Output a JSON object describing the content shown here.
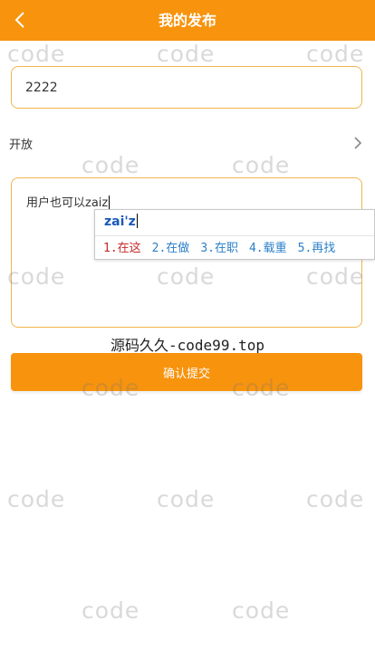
{
  "header": {
    "title": "我的发布",
    "back_icon": "chevron-left-icon",
    "background": "#f7930d"
  },
  "form": {
    "title_value": "2222",
    "visibility_label": "开放",
    "visibility_icon": "chevron-right-icon",
    "content_value": "用户也可以zaiz",
    "submit_label": "确认提交"
  },
  "ime": {
    "composition": "zai'z",
    "candidates": [
      "1.在这",
      "2.在做",
      "3.在职",
      "4.载重",
      "5.再找"
    ]
  },
  "caption": "源码久久-code99.top",
  "watermark": "code",
  "colors": {
    "accent": "#f7930d",
    "border": "#f2b54f"
  }
}
